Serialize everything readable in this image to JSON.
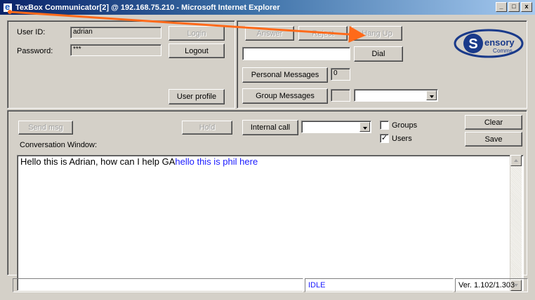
{
  "window": {
    "title": "TexBox Communicator[2] @ 192.168.75.210 - Microsoft Internet Explorer",
    "controls": {
      "minimize": "_",
      "maximize": "□",
      "close": "x"
    }
  },
  "login": {
    "user_id_label": "User ID:",
    "user_id_value": "adrian",
    "password_label": "Password:",
    "password_value": "***",
    "login_button": "Login",
    "logout_button": "Logout",
    "profile_button": "User profile"
  },
  "call": {
    "answer_button": "Answer",
    "reject_button": "Reject",
    "hangup_button": "Hang Up",
    "dial_input_value": "",
    "dial_button": "Dial",
    "personal_messages_button": "Personal Messages",
    "personal_messages_count": "0",
    "group_messages_button": "Group Messages",
    "group_messages_count": "",
    "group_select_value": ""
  },
  "logo": {
    "brand": "ensory",
    "initial": "S",
    "sub": "omms",
    "sub_initial": "C"
  },
  "controls": {
    "send_button": "Send msg",
    "hold_button": "Hold",
    "internal_call_button": "Internal call",
    "internal_select_value": "",
    "groups_label": "Groups",
    "groups_checked": false,
    "users_label": "Users",
    "users_checked": true,
    "clear_button": "Clear",
    "save_button": "Save"
  },
  "conversation": {
    "label": "Conversation Window:",
    "local_text": "Hello this is Adrian, how can I help GA",
    "remote_text": "hello this is phil here",
    "local_color": "#000000",
    "remote_color": "#1a1aff"
  },
  "status": {
    "message": "",
    "state": "IDLE",
    "version": "Ver. 1.102/1.303"
  },
  "colors": {
    "annotation_arrow": "#ff6a1a",
    "title_gradient_start": "#0a246a",
    "idle_text": "#1a1aff"
  }
}
